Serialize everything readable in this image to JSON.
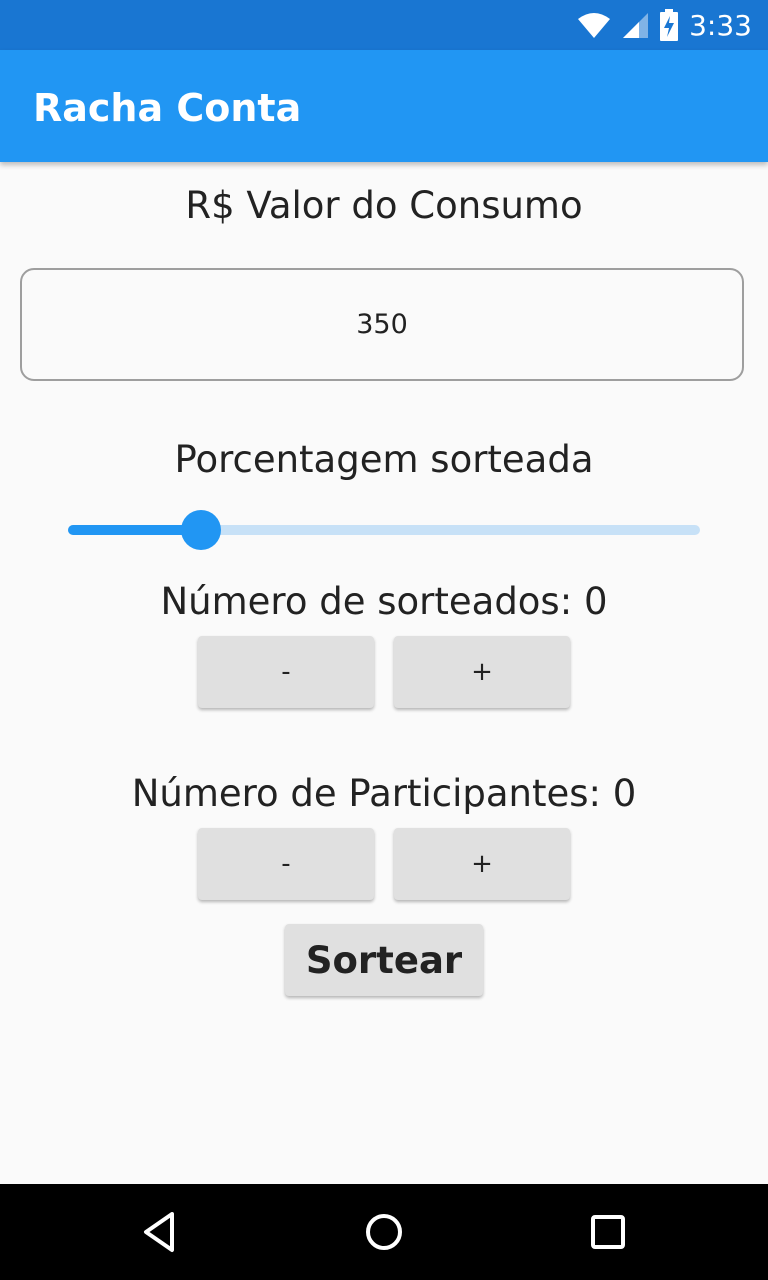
{
  "status_bar": {
    "time": "3:33",
    "icons": [
      "wifi-icon",
      "signal-icon",
      "battery-charging-icon"
    ]
  },
  "app_bar": {
    "title": "Racha Conta"
  },
  "consumo": {
    "label": "R$ Valor do Consumo",
    "value": "350"
  },
  "porcentagem": {
    "label": "Porcentagem sorteada",
    "slider_fraction": 0.21
  },
  "sorteados": {
    "label": "Número de sorteados: 0",
    "minus_label": "-",
    "plus_label": "+"
  },
  "participantes": {
    "label": "Número de Participantes: 0",
    "minus_label": "-",
    "plus_label": "+"
  },
  "sortear_label": "Sortear",
  "nav_bar": {
    "icons": [
      "back-icon",
      "home-icon",
      "recents-icon"
    ]
  },
  "colors": {
    "primary": "#2196f3",
    "primary_dark": "#1976d2",
    "slider_inactive": "#c7e1f7",
    "button": "#e0e0e0",
    "background": "#fafafa"
  }
}
